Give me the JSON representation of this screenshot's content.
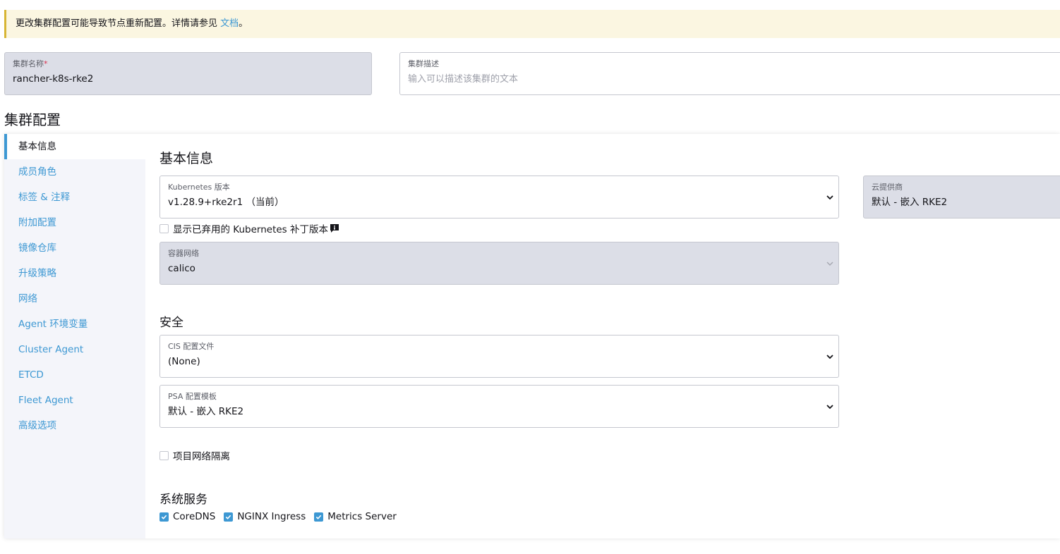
{
  "banner": {
    "text": "更改集群配置可能导致节点重新配置。详情请参见",
    "link": "文档",
    "suffix": "。"
  },
  "cluster_name": {
    "label": "集群名称",
    "required_mark": "*",
    "value": "rancher-k8s-rke2"
  },
  "cluster_desc": {
    "label": "集群描述",
    "placeholder": "输入可以描述该集群的文本"
  },
  "section_title": "集群配置",
  "sidebar": {
    "items": [
      {
        "label": "基本信息",
        "active": true
      },
      {
        "label": "成员角色"
      },
      {
        "label": "标签 & 注释"
      },
      {
        "label": "附加配置"
      },
      {
        "label": "镜像仓库"
      },
      {
        "label": "升级策略"
      },
      {
        "label": "网络"
      },
      {
        "label": "Agent 环境变量"
      },
      {
        "label": "Cluster Agent"
      },
      {
        "label": "ETCD"
      },
      {
        "label": "Fleet Agent"
      },
      {
        "label": "高级选项"
      }
    ]
  },
  "basic": {
    "title": "基本信息",
    "k8s_version": {
      "label": "Kubernetes 版本",
      "value": "v1.28.9+rke2r1 （当前）"
    },
    "deprecated_checkbox": {
      "label": "显示已弃用的 Kubernetes 补丁版本",
      "checked": false
    },
    "cloud_provider": {
      "label": "云提供商",
      "value": "默认 - 嵌入 RKE2"
    },
    "cni": {
      "label": "容器网络",
      "value": "calico"
    }
  },
  "security": {
    "title": "安全",
    "cis": {
      "label": "CIS 配置文件",
      "value": "(None)"
    },
    "psa": {
      "label": "PSA 配置模板",
      "value": "默认 - 嵌入 RKE2"
    },
    "project_isolation": {
      "label": "项目网络隔离",
      "checked": false
    }
  },
  "system_services": {
    "title": "系统服务",
    "items": [
      {
        "label": "CoreDNS",
        "checked": true
      },
      {
        "label": "NGINX Ingress",
        "checked": true
      },
      {
        "label": "Metrics Server",
        "checked": true
      }
    ]
  },
  "colors": {
    "accent": "#3d98d3",
    "banner_bg": "#fbf6e1",
    "banner_border": "#d7b534",
    "disabled_bg": "#dcdee7",
    "required": "#d9304d"
  }
}
